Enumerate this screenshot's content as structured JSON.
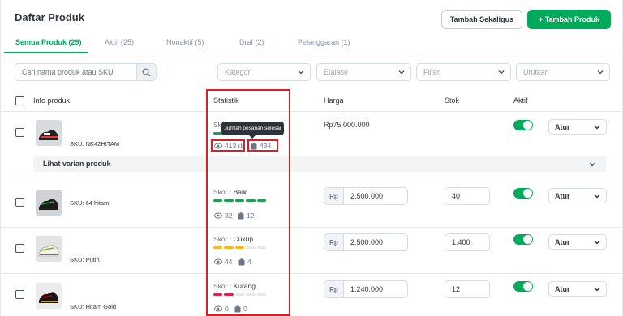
{
  "header": {
    "title": "Daftar Produk",
    "bulk_add_label": "Tambah Sekaligus",
    "add_label": "+ Tambah Produk"
  },
  "tabs": [
    {
      "label": "Semua Produk (29)"
    },
    {
      "label": "Aktif (25)"
    },
    {
      "label": "Nonaktif (5)"
    },
    {
      "label": "Draf (2)"
    },
    {
      "label": "Pelanggaran (1)"
    }
  ],
  "filters": {
    "search_placeholder": "Cari nama produk atau SKU",
    "kategori": "Kategori",
    "etalase": "Etalase",
    "filter": "Filter",
    "urutkan": "Urutkan"
  },
  "columns": {
    "info": "Info produk",
    "statistik": "Statistik",
    "harga": "Harga",
    "stok": "Stok",
    "aktif": "Aktif"
  },
  "tooltip": "Jumlah pesanan selesai",
  "variant_label": "Lihat varian produk",
  "rows": [
    {
      "sku": "SKU: NK42HITAM",
      "skor": "Skor : Baik",
      "views": "413 rb",
      "orders": "434",
      "price": "Rp75.000.000",
      "stock": "",
      "action": "Atur"
    },
    {
      "sku": "SKU: 64 hitam",
      "skor_prefix": "Skor : ",
      "skor": "Baik",
      "views": "32",
      "orders": "12",
      "rp": "Rp",
      "price": "2.500.000",
      "stock": "40",
      "action": "Atur"
    },
    {
      "sku": "SKU: Putih",
      "skor_prefix": "Skor : ",
      "skor": "Cukup",
      "views": "44",
      "orders": "4",
      "rp": "Rp",
      "price": "2.500.000",
      "stock": "1.400",
      "action": "Atur"
    },
    {
      "sku": "SKU: Hitam Gold",
      "skor_prefix": "Skor : ",
      "skor": "Kurang",
      "views": "0",
      "orders": "0",
      "rp": "Rp",
      "price": "1.240.000",
      "stock": "12",
      "action": "Atur"
    }
  ],
  "colors": {
    "brand_green": "#00aa5b",
    "score_good": "#17a34a",
    "score_fair": "#fdb813",
    "score_poor": "#e91e54",
    "highlight_red": "#e31b23"
  }
}
